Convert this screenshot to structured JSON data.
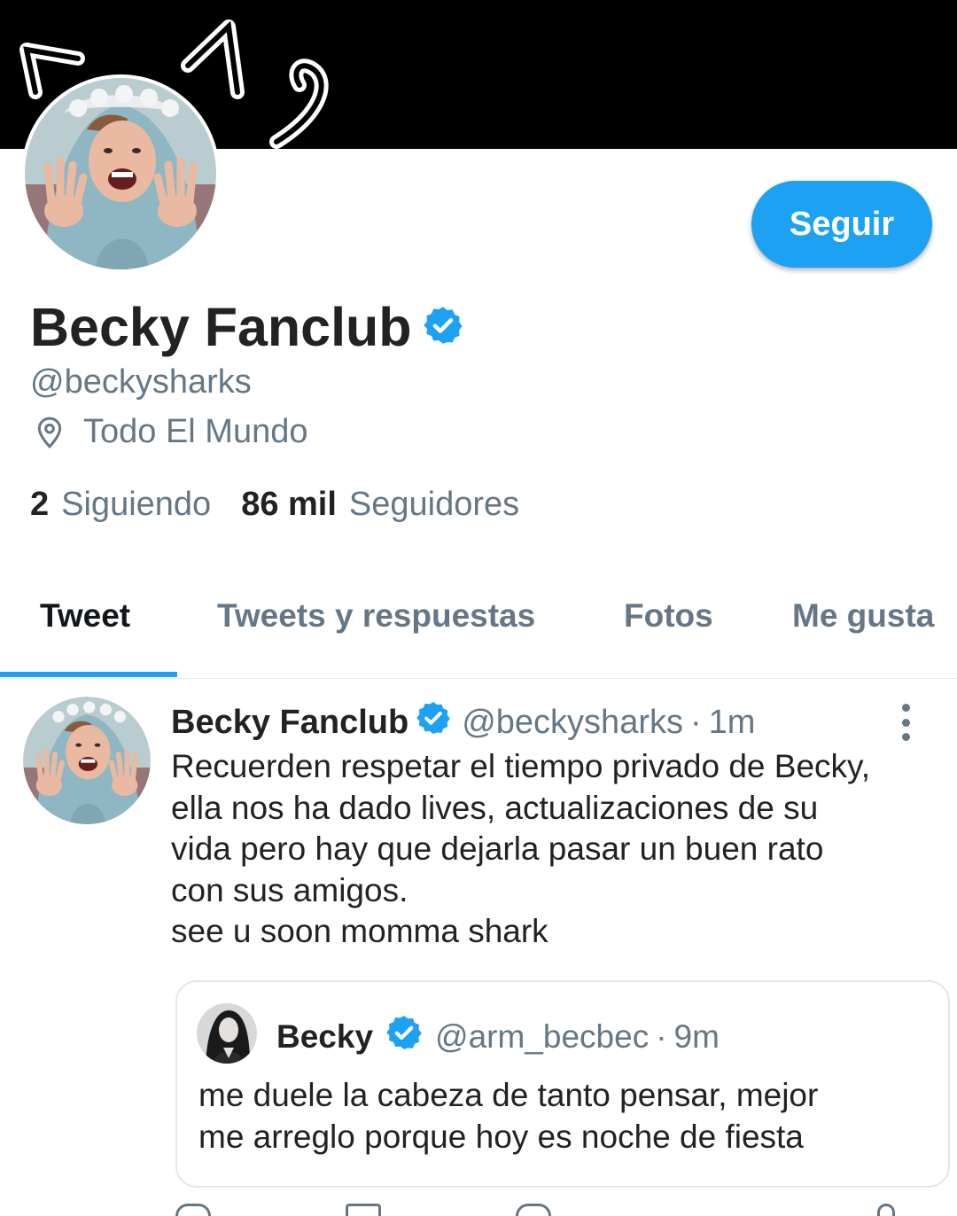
{
  "theme": {
    "accent": "#1da1f2",
    "muted": "#657786",
    "text": "#14171a"
  },
  "profile": {
    "banner_icon": "cat-ears-doodle",
    "name": "Becky Fanclub",
    "verified_icon": "verified-badge-icon",
    "handle": "@beckysharks",
    "location": "Todo El Mundo",
    "location_icon": "map-pin-icon",
    "following_count": "2",
    "following_label": "Siguiendo",
    "followers_count": "86 mil",
    "followers_label": "Seguidores",
    "follow_button": "Seguir"
  },
  "tabs": [
    {
      "label": "Tweet",
      "active": true
    },
    {
      "label": "Tweets y respuestas",
      "active": false
    },
    {
      "label": "Fotos",
      "active": false
    },
    {
      "label": "Me gusta",
      "active": false
    }
  ],
  "tweet": {
    "author": "Becky Fanclub",
    "handle": "@beckysharks",
    "separator": "·",
    "time": "1m",
    "more_icon": "more-vertical-icon",
    "text_lines": [
      "Recuerden respetar el tiempo privado de Becky,",
      "ella nos ha dado lives, actualizaciones de su",
      "vida pero hay que dejarla pasar un buen rato",
      "con sus amigos.",
      "see u soon momma shark"
    ],
    "quoted": {
      "author": "Becky",
      "handle": "@arm_becbec",
      "separator": "·",
      "time": "9m",
      "text_lines": [
        "me duele la cabeza de tanto pensar, mejor",
        "me arreglo porque hoy es noche de fiesta"
      ]
    },
    "action_icons": [
      "reply-icon",
      "retweet-icon",
      "like-icon",
      "share-icon"
    ]
  }
}
